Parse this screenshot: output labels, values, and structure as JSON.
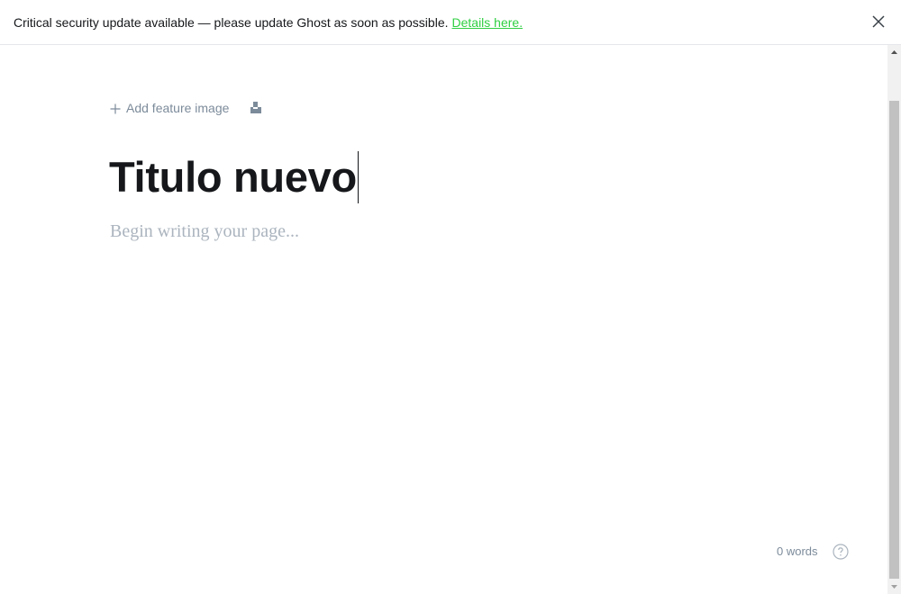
{
  "alert": {
    "message": "Critical security update available — please update Ghost as soon as possible.",
    "link_label": "Details here."
  },
  "editor": {
    "feature_image_label": "Add feature image",
    "title": "Titulo nuevo",
    "body_placeholder": "Begin writing your page..."
  },
  "footer": {
    "word_count": "0 words"
  },
  "icons": {
    "close": "close-icon",
    "plus": "plus-icon",
    "snippet": "snippet-icon",
    "help": "help-icon"
  },
  "colors": {
    "accent_link": "#30cf43",
    "text_primary": "#15171a",
    "text_muted": "#7c8b9a",
    "placeholder": "#abb4be"
  }
}
